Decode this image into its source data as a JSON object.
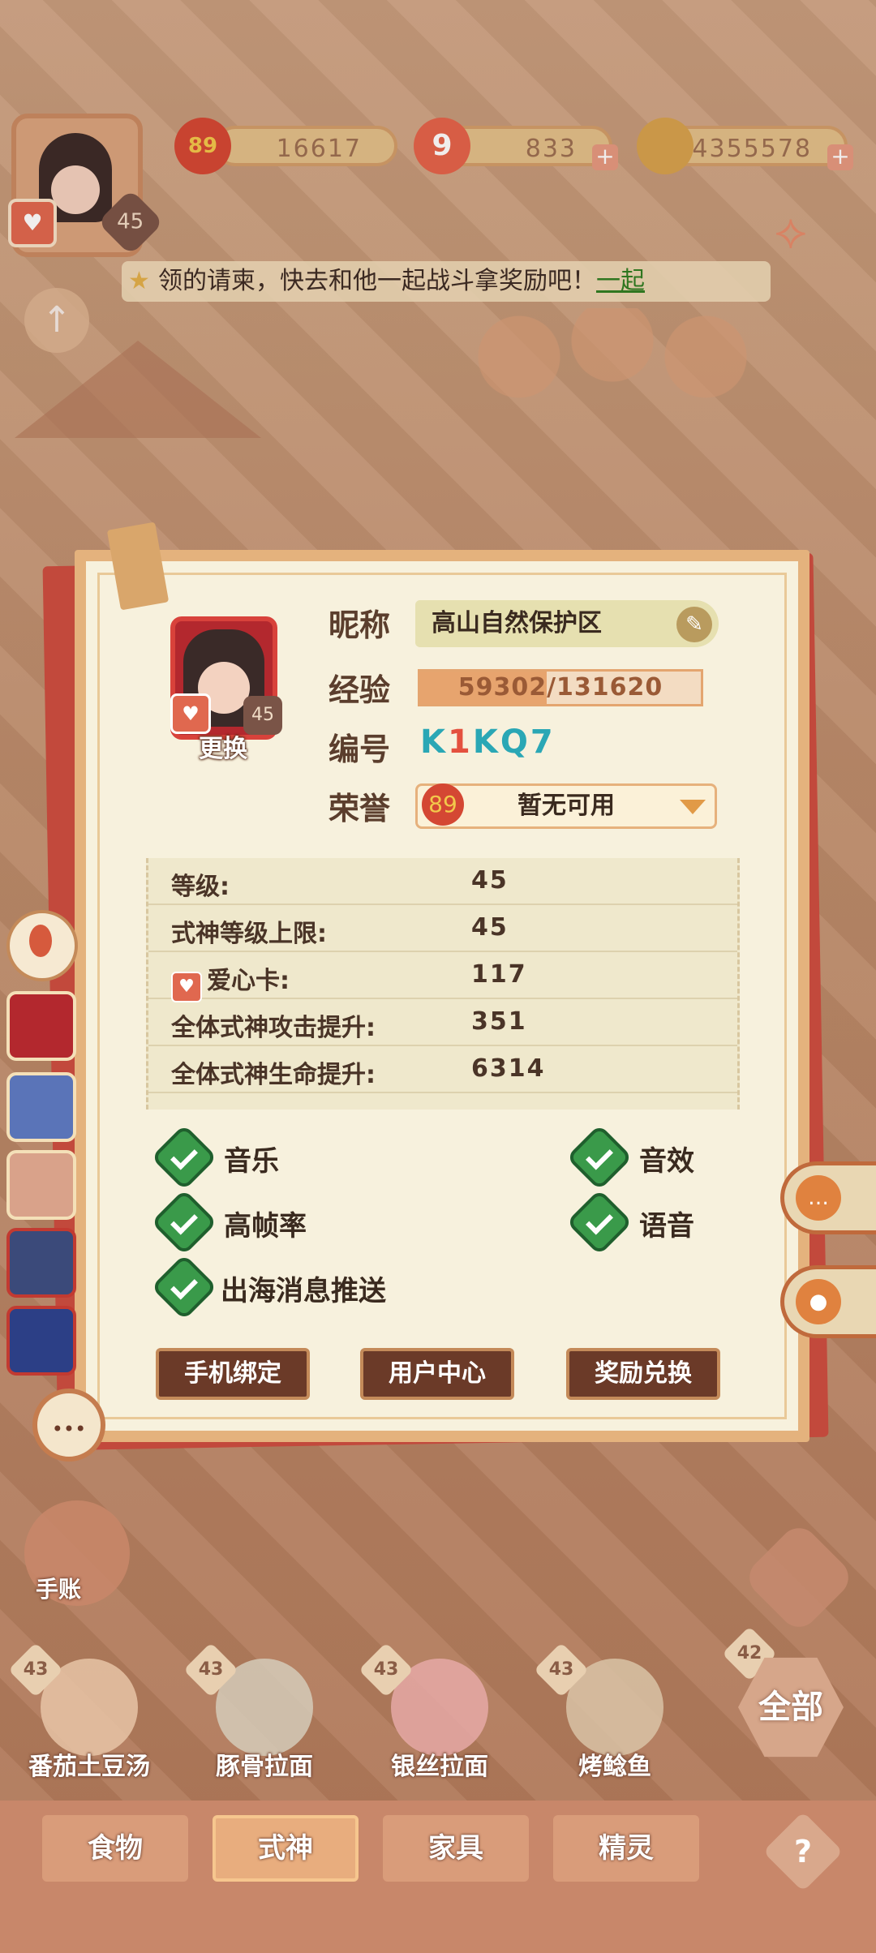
{
  "top_bar": {
    "player_level": "45",
    "honor_badge_level": "89",
    "honor_points": "16617",
    "gems": "833",
    "coins": "4355578",
    "plus_label": "+"
  },
  "banner": {
    "text": "领的请柬，快去和他一起战斗拿奖励吧！",
    "link": "一起"
  },
  "profile": {
    "change_label": "更换",
    "avatar_level": "45",
    "nickname_label": "昵称",
    "nickname": "高山自然保护区",
    "exp_label": "经验",
    "exp_current": 59302,
    "exp_max": 131620,
    "exp_text": "59302/131620",
    "id_label": "编号",
    "id_part1": "K",
    "id_part2": "1",
    "id_part3": "KQ7",
    "honor_label": "荣誉",
    "honor_value": "暂无可用"
  },
  "stats": [
    {
      "key": "等级:",
      "value": "45"
    },
    {
      "key": "式神等级上限:",
      "value": "45"
    },
    {
      "key": "爱心卡:",
      "value": "117"
    },
    {
      "key": "全体式神攻击提升:",
      "value": "351"
    },
    {
      "key": "全体式神生命提升:",
      "value": "6314"
    }
  ],
  "settings": {
    "music": "音乐",
    "sfx": "音效",
    "high_fps": "高帧率",
    "voice": "语音",
    "push": "出海消息推送"
  },
  "buttons": {
    "phone_bind": "手机绑定",
    "user_center": "用户中心",
    "redeem": "奖励兑换"
  },
  "handbook_label": "手账",
  "dishes": [
    {
      "level": "43",
      "name": "番茄土豆汤"
    },
    {
      "level": "43",
      "name": "豚骨拉面"
    },
    {
      "level": "43",
      "name": "银丝拉面"
    },
    {
      "level": "43",
      "name": "烤鲶鱼"
    }
  ],
  "all_label": "全部",
  "last_dish_level": "42",
  "bottom_tabs": [
    "食物",
    "式神",
    "家具",
    "精灵"
  ],
  "help_label": "?"
}
